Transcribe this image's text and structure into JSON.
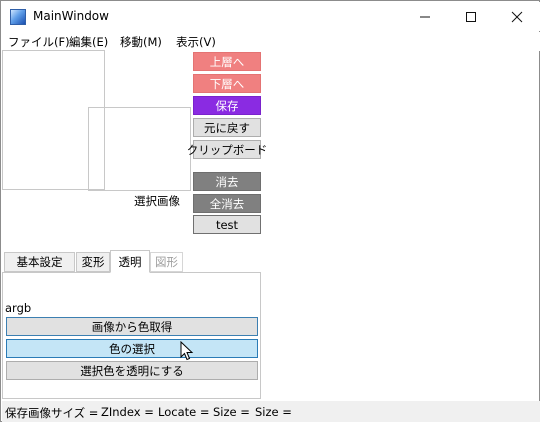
{
  "window": {
    "title": "MainWindow",
    "minimize_glyph": "—",
    "maximize_glyph": "☐",
    "close_glyph": "✕"
  },
  "menu": [
    {
      "label": "ファイル(F)"
    },
    {
      "label": "編集(E)"
    },
    {
      "label": "移動(M)"
    },
    {
      "label": "表示(V)"
    }
  ],
  "canvas": {
    "image_label": "選択画像"
  },
  "side_buttons": {
    "to_top": "上層へ",
    "to_bottom": "下層へ",
    "save": "保存",
    "undo": "元に戻す",
    "clipboard": "クリップボード",
    "delete": "消去",
    "delete_all": "全消去",
    "test": "test"
  },
  "tabs": [
    {
      "label": "基本設定",
      "state": "normal"
    },
    {
      "label": "変形",
      "state": "normal"
    },
    {
      "label": "透明",
      "state": "active"
    },
    {
      "label": "図形",
      "state": "disabled"
    }
  ],
  "transparency_tab": {
    "color_text": "argb",
    "pick_from_image": "画像から色取得",
    "select_color": "色の選択",
    "make_transparent": "選択色を透明にする"
  },
  "statusbar": [
    {
      "text": "保存画像サイズ ="
    },
    {
      "text": "ZIndex ="
    },
    {
      "text": "Locate ="
    },
    {
      "text": "Size ="
    },
    {
      "text": "Size ="
    }
  ],
  "colors": {
    "salmon": "#f08080",
    "purple": "#8a2be2",
    "dark_gray": "#808080",
    "hover_blue": "#c4e5f6",
    "hover_border": "#2a7bb6"
  }
}
